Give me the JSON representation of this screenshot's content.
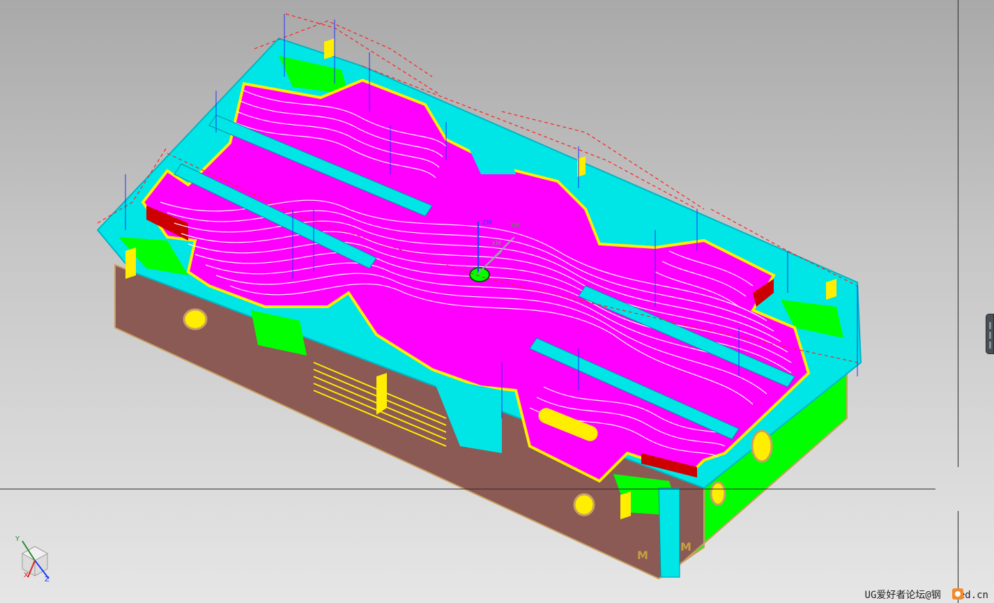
{
  "viewport": {
    "background_top": "#a9a9a9",
    "background_bottom": "#e6e6e6"
  },
  "model": {
    "description_colors": {
      "cavity_face": "#ff00ff",
      "toolpath_white": "#ffffff",
      "walls_cyan": "#00ffff",
      "floor_green": "#00ff00",
      "side_brown": "#8b5a55",
      "accent_yellow": "#ffee00",
      "red_edge": "#cc0000",
      "rapid_red": "#ff2020",
      "feed_blue": "#2020ff"
    },
    "side_marks": [
      "M",
      "M"
    ],
    "mcs_labels": {
      "zm": "ZM",
      "ym": "YM",
      "xm": "XM"
    }
  },
  "triad": {
    "x_label": "X",
    "y_label": "Y",
    "z_label": "Z"
  },
  "footer": {
    "watermark": "UG爱好者论坛@钢",
    "watermark_tail": "ed.cn"
  }
}
